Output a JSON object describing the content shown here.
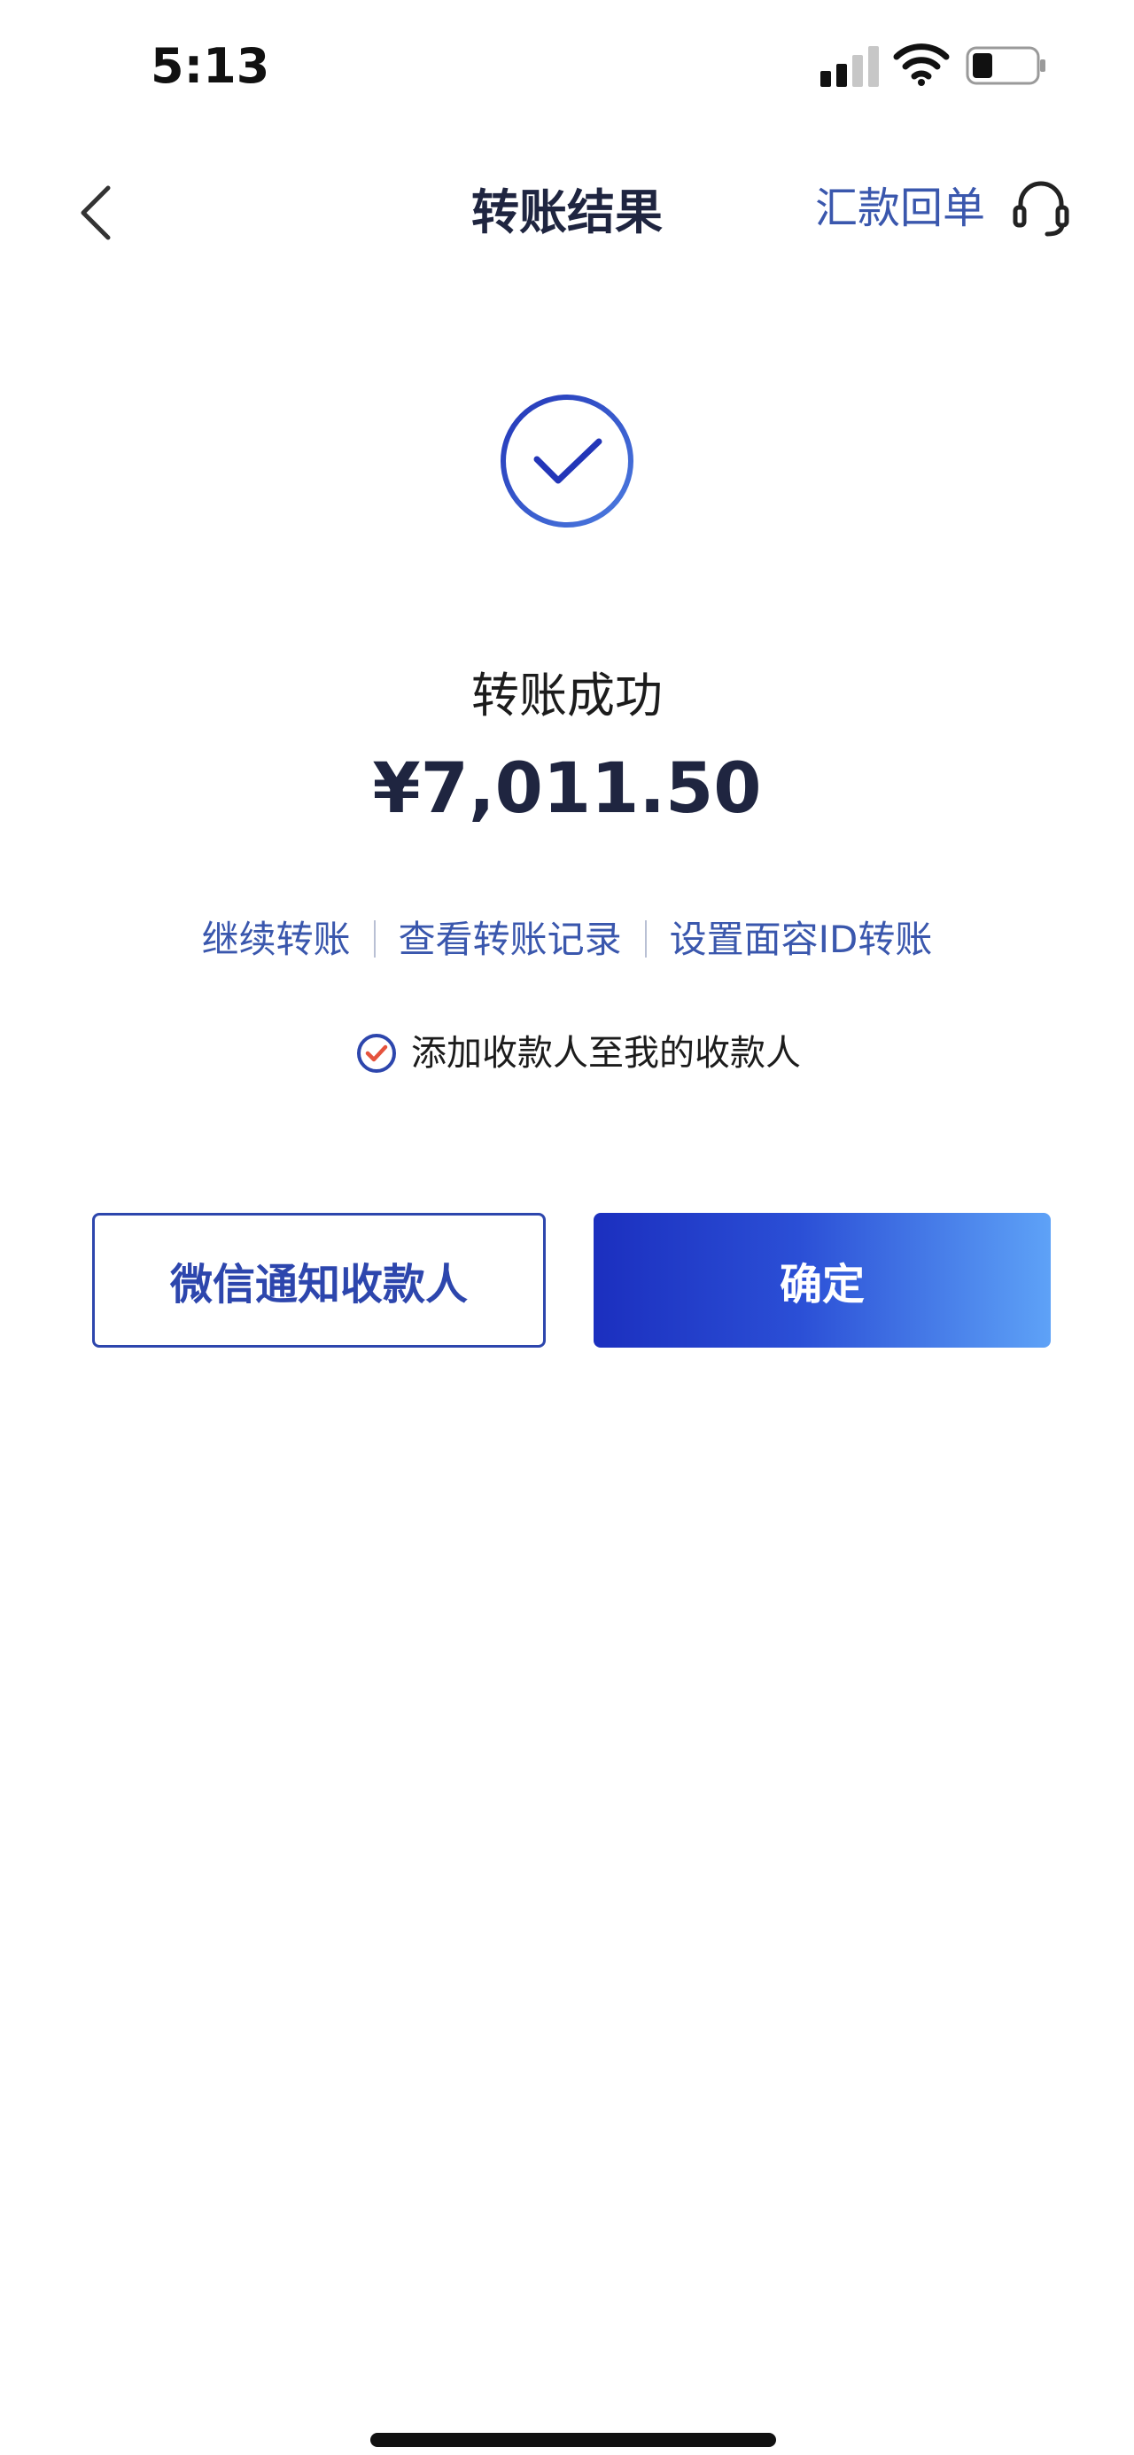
{
  "status_bar": {
    "time": "5:13",
    "icons": [
      "cellular-signal-icon",
      "wifi-icon",
      "battery-icon"
    ]
  },
  "nav": {
    "back_icon": "chevron-left-icon",
    "title": "转账结果",
    "receipt_link": "汇款回单",
    "support_icon": "headset-icon"
  },
  "result": {
    "icon": "check-circle-icon",
    "status_text": "转账成功",
    "amount": "¥7,011.50"
  },
  "actions": {
    "continue_transfer": "继续转账",
    "view_records": "查看转账记录",
    "setup_face_id": "设置面容ID转账"
  },
  "add_payee": {
    "checked": true,
    "label": "添加收款人至我的收款人"
  },
  "buttons": {
    "wechat_notify": "微信通知收款人",
    "confirm": "确定"
  },
  "colors": {
    "accent": "#2d46ad",
    "link": "#3a57ad",
    "title": "#1f2540",
    "confirm_gradient_start": "#1b2fbf",
    "confirm_gradient_end": "#5ea2f7",
    "checkbox_mark": "#e5533d"
  }
}
